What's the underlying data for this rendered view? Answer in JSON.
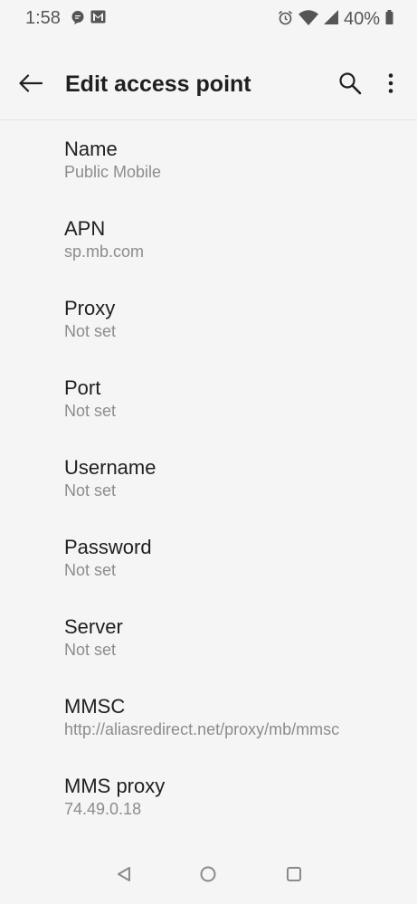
{
  "status_bar": {
    "time": "1:58",
    "battery": "40%"
  },
  "app_bar": {
    "title": "Edit access point"
  },
  "settings": [
    {
      "title": "Name",
      "value": "Public Mobile"
    },
    {
      "title": "APN",
      "value": "sp.mb.com"
    },
    {
      "title": "Proxy",
      "value": "Not set"
    },
    {
      "title": "Port",
      "value": "Not set"
    },
    {
      "title": "Username",
      "value": "Not set"
    },
    {
      "title": "Password",
      "value": "Not set"
    },
    {
      "title": "Server",
      "value": "Not set"
    },
    {
      "title": "MMSC",
      "value": "http://aliasredirect.net/proxy/mb/mmsc"
    },
    {
      "title": "MMS proxy",
      "value": "74.49.0.18"
    }
  ],
  "icons": {
    "status": [
      "message-icon",
      "gmail-icon",
      "alarm-icon",
      "wifi-icon",
      "signal-icon",
      "battery-icon"
    ],
    "app_bar": [
      "back-arrow-icon",
      "search-icon",
      "more-vert-icon"
    ],
    "nav": [
      "nav-back-icon",
      "nav-home-icon",
      "nav-recents-icon"
    ]
  },
  "colors": {
    "background": "#f5f5f5",
    "title_text": "#1f1f1f",
    "secondary_text": "#8c8c8c",
    "status_icons": "#555555"
  }
}
